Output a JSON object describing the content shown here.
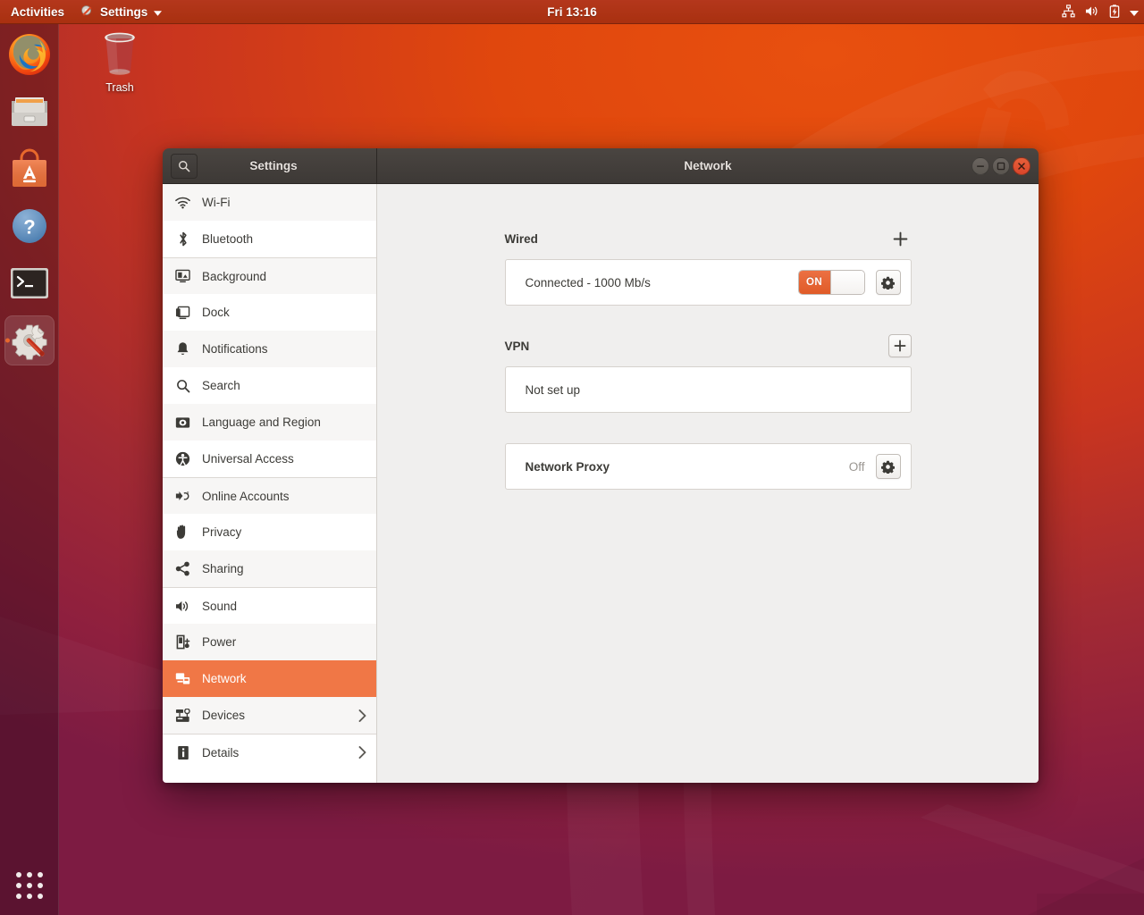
{
  "topbar": {
    "activities": "Activities",
    "app_menu": "Settings",
    "app_menu_icon": "settings-app-icon",
    "dropdown_icon": "chevron-down-icon",
    "clock": "Fri 13:16",
    "status_icons": [
      "network-wired-icon",
      "volume-icon",
      "battery-charging-icon",
      "chevron-down-icon"
    ]
  },
  "dock": {
    "items": [
      {
        "name": "firefox",
        "label": "Firefox",
        "active": false
      },
      {
        "name": "files",
        "label": "Files",
        "active": false
      },
      {
        "name": "software",
        "label": "Ubuntu Software",
        "active": false
      },
      {
        "name": "help",
        "label": "Help",
        "active": false
      },
      {
        "name": "terminal",
        "label": "Terminal",
        "active": false
      },
      {
        "name": "settings",
        "label": "Settings",
        "active": true
      }
    ],
    "apps_button": "show-applications"
  },
  "desktop": {
    "trash_label": "Trash"
  },
  "window": {
    "title": "Network",
    "sidebar_title": "Settings",
    "search_icon": "search-icon",
    "controls": {
      "minimize": "minimize-button",
      "maximize": "maximize-button",
      "close": "close-button"
    }
  },
  "sidebar": {
    "items": [
      {
        "label": "Wi-Fi",
        "icon": "wifi-icon",
        "alt": true,
        "sep": false,
        "selected": false,
        "chevron": false
      },
      {
        "label": "Bluetooth",
        "icon": "bluetooth-icon",
        "alt": false,
        "sep": false,
        "selected": false,
        "chevron": false
      },
      {
        "label": "Background",
        "icon": "background-icon",
        "alt": true,
        "sep": true,
        "selected": false,
        "chevron": false
      },
      {
        "label": "Dock",
        "icon": "dock-icon",
        "alt": false,
        "sep": false,
        "selected": false,
        "chevron": false
      },
      {
        "label": "Notifications",
        "icon": "bell-icon",
        "alt": true,
        "sep": false,
        "selected": false,
        "chevron": false
      },
      {
        "label": "Search",
        "icon": "search-icon",
        "alt": false,
        "sep": false,
        "selected": false,
        "chevron": false
      },
      {
        "label": "Language and Region",
        "icon": "language-icon",
        "alt": true,
        "sep": false,
        "selected": false,
        "chevron": false
      },
      {
        "label": "Universal Access",
        "icon": "accessibility-icon",
        "alt": false,
        "sep": false,
        "selected": false,
        "chevron": false
      },
      {
        "label": "Online Accounts",
        "icon": "online-accounts-icon",
        "alt": true,
        "sep": true,
        "selected": false,
        "chevron": false
      },
      {
        "label": "Privacy",
        "icon": "privacy-hand-icon",
        "alt": false,
        "sep": false,
        "selected": false,
        "chevron": false
      },
      {
        "label": "Sharing",
        "icon": "sharing-icon",
        "alt": true,
        "sep": false,
        "selected": false,
        "chevron": false
      },
      {
        "label": "Sound",
        "icon": "sound-icon",
        "alt": false,
        "sep": true,
        "selected": false,
        "chevron": false
      },
      {
        "label": "Power",
        "icon": "power-icon",
        "alt": true,
        "sep": false,
        "selected": false,
        "chevron": false
      },
      {
        "label": "Network",
        "icon": "network-icon",
        "alt": false,
        "sep": false,
        "selected": true,
        "chevron": false
      },
      {
        "label": "Devices",
        "icon": "devices-icon",
        "alt": true,
        "sep": false,
        "selected": false,
        "chevron": true
      },
      {
        "label": "Details",
        "icon": "details-info-icon",
        "alt": false,
        "sep": true,
        "selected": false,
        "chevron": true
      }
    ]
  },
  "main": {
    "wired": {
      "title": "Wired",
      "add_icon": "plus-icon",
      "status": "Connected - 1000 Mb/s",
      "toggle_label": "ON",
      "toggle_on": true,
      "settings_icon": "gear-icon"
    },
    "vpn": {
      "title": "VPN",
      "add_icon": "plus-icon",
      "status": "Not set up"
    },
    "proxy": {
      "title": "Network Proxy",
      "state": "Off",
      "settings_icon": "gear-icon"
    }
  },
  "colors": {
    "accent": "#e95420",
    "selection": "#f07746",
    "toggle_on": "#e05b27",
    "headerbar": "#3d3936",
    "content_bg": "#f0efee"
  }
}
